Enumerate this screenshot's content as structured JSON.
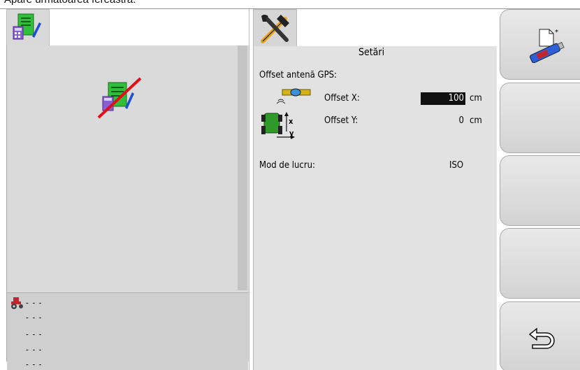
{
  "caption": "Apare următoarea fereastră:",
  "left_panel": {
    "dashes": [
      "- - -",
      "- - -",
      "- - -",
      "- - -",
      "- - -"
    ]
  },
  "settings": {
    "title": "Setări",
    "gps_offset_label": "Offset antenă GPS:",
    "offset_x_label": "Offset X:",
    "offset_x_value": "100",
    "offset_x_unit": "cm",
    "offset_y_label": "Offset Y:",
    "offset_y_value": "0",
    "offset_y_unit": "cm",
    "axis_x": "x",
    "axis_y": "y",
    "mode_label": "Mod de lucru:",
    "mode_value": "ISO"
  },
  "softkeys": [
    "new-document-usb-icon",
    "empty",
    "empty",
    "empty",
    "back-icon"
  ],
  "colors": {
    "panel_bg": "#dadada",
    "settings_bg": "#e2e2e2",
    "highlight": "#111111",
    "doc_green": "#2fbf3a",
    "strike_red": "#e0101a"
  }
}
